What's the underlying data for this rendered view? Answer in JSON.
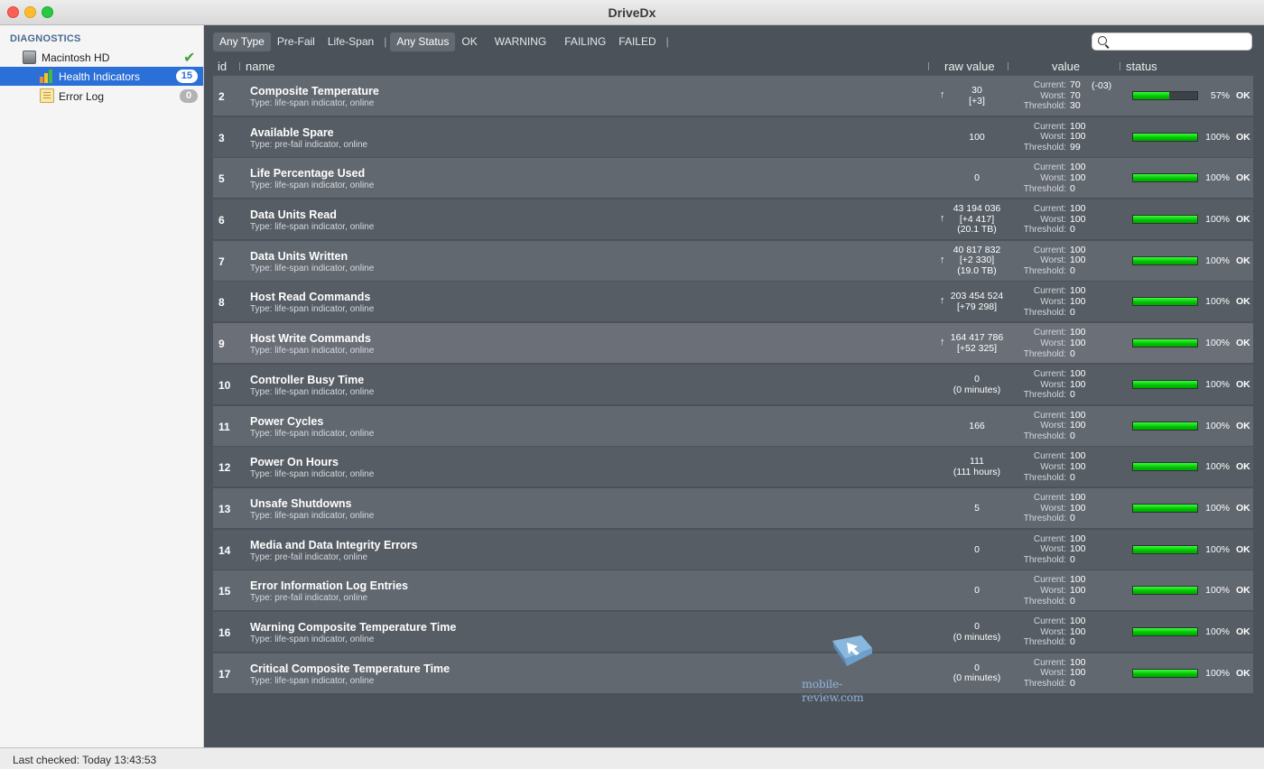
{
  "window": {
    "title": "DriveDx"
  },
  "sidebar": {
    "header": "DIAGNOSTICS",
    "disk": {
      "label": "Macintosh HD",
      "icon": "hard-disk-icon"
    },
    "items": [
      {
        "label": "Health Indicators",
        "count": "15",
        "icon": "bar-chart-icon"
      },
      {
        "label": "Error Log",
        "count": "0",
        "icon": "log-document-icon"
      }
    ]
  },
  "filters": {
    "type": [
      "Any Type",
      "Pre-Fail",
      "Life-Span"
    ],
    "status": [
      "Any Status",
      "OK",
      "WARNING",
      "FAILING",
      "FAILED"
    ]
  },
  "table": {
    "headers": {
      "id": "id",
      "name": "name",
      "raw": "raw value",
      "value": "value",
      "status": "status"
    },
    "value_labels": [
      "Current:",
      "Worst:",
      "Threshold:"
    ],
    "rows": [
      {
        "id": "2",
        "name": "Composite Temperature",
        "type": "Type: life-span indicator, online",
        "raw": [
          "30",
          "[+3]"
        ],
        "trend": "↑",
        "current": "70",
        "worst": "70",
        "threshold": "30",
        "delta": "(-03)",
        "pct": "57%",
        "status": "OK"
      },
      {
        "id": "3",
        "name": "Available Spare",
        "type": "Type: pre-fail indicator, online",
        "raw": [
          "100"
        ],
        "trend": "",
        "current": "100",
        "worst": "100",
        "threshold": "99",
        "delta": "",
        "pct": "100%",
        "status": "OK"
      },
      {
        "id": "5",
        "name": "Life Percentage Used",
        "type": "Type: life-span indicator, online",
        "raw": [
          "0"
        ],
        "trend": "",
        "current": "100",
        "worst": "100",
        "threshold": "0",
        "delta": "",
        "pct": "100%",
        "status": "OK"
      },
      {
        "id": "6",
        "name": "Data Units Read",
        "type": "Type: life-span indicator, online",
        "raw": [
          "43 194 036",
          "[+4 417]",
          "(20.1 TB)"
        ],
        "trend": "↑",
        "current": "100",
        "worst": "100",
        "threshold": "0",
        "delta": "",
        "pct": "100%",
        "status": "OK"
      },
      {
        "id": "7",
        "name": "Data Units Written",
        "type": "Type: life-span indicator, online",
        "raw": [
          "40 817 832",
          "[+2 330]",
          "(19.0 TB)"
        ],
        "trend": "↑",
        "current": "100",
        "worst": "100",
        "threshold": "0",
        "delta": "",
        "pct": "100%",
        "status": "OK"
      },
      {
        "id": "8",
        "name": "Host Read Commands",
        "type": "Type: life-span indicator, online",
        "raw": [
          "203 454 524",
          "[+79 298]"
        ],
        "trend": "↑",
        "current": "100",
        "worst": "100",
        "threshold": "0",
        "delta": "",
        "pct": "100%",
        "status": "OK"
      },
      {
        "id": "9",
        "name": "Host Write Commands",
        "type": "Type: life-span indicator, online",
        "raw": [
          "164 417 786",
          "[+52 325]"
        ],
        "trend": "↑",
        "current": "100",
        "worst": "100",
        "threshold": "0",
        "delta": "",
        "pct": "100%",
        "status": "OK"
      },
      {
        "id": "10",
        "name": "Controller Busy Time",
        "type": "Type: life-span indicator, online",
        "raw": [
          "0",
          "(0 minutes)"
        ],
        "trend": "",
        "current": "100",
        "worst": "100",
        "threshold": "0",
        "delta": "",
        "pct": "100%",
        "status": "OK"
      },
      {
        "id": "11",
        "name": "Power Cycles",
        "type": "Type: life-span indicator, online",
        "raw": [
          "166"
        ],
        "trend": "",
        "current": "100",
        "worst": "100",
        "threshold": "0",
        "delta": "",
        "pct": "100%",
        "status": "OK"
      },
      {
        "id": "12",
        "name": "Power On Hours",
        "type": "Type: life-span indicator, online",
        "raw": [
          "111",
          "(111 hours)"
        ],
        "trend": "",
        "current": "100",
        "worst": "100",
        "threshold": "0",
        "delta": "",
        "pct": "100%",
        "status": "OK"
      },
      {
        "id": "13",
        "name": "Unsafe Shutdowns",
        "type": "Type: life-span indicator, online",
        "raw": [
          "5"
        ],
        "trend": "",
        "current": "100",
        "worst": "100",
        "threshold": "0",
        "delta": "",
        "pct": "100%",
        "status": "OK"
      },
      {
        "id": "14",
        "name": "Media and Data Integrity Errors",
        "type": "Type: pre-fail indicator, online",
        "raw": [
          "0"
        ],
        "trend": "",
        "current": "100",
        "worst": "100",
        "threshold": "0",
        "delta": "",
        "pct": "100%",
        "status": "OK"
      },
      {
        "id": "15",
        "name": "Error Information Log Entries",
        "type": "Type: pre-fail indicator, online",
        "raw": [
          "0"
        ],
        "trend": "",
        "current": "100",
        "worst": "100",
        "threshold": "0",
        "delta": "",
        "pct": "100%",
        "status": "OK"
      },
      {
        "id": "16",
        "name": "Warning Composite Temperature Time",
        "type": "Type: life-span indicator, online",
        "raw": [
          "0",
          "(0 minutes)"
        ],
        "trend": "",
        "current": "100",
        "worst": "100",
        "threshold": "0",
        "delta": "",
        "pct": "100%",
        "status": "OK"
      },
      {
        "id": "17",
        "name": "Critical Composite Temperature Time",
        "type": "Type: life-span indicator, online",
        "raw": [
          "0",
          "(0 minutes)"
        ],
        "trend": "",
        "current": "100",
        "worst": "100",
        "threshold": "0",
        "delta": "",
        "pct": "100%",
        "status": "OK"
      }
    ]
  },
  "statusbar": {
    "text": "Last checked: Today 13:43:53"
  },
  "watermark": {
    "text": "mobile-review.com"
  },
  "colors": {
    "selection": "#2b6fd8",
    "bar_fill": "#00c000",
    "content_bg": "#4b5259"
  }
}
